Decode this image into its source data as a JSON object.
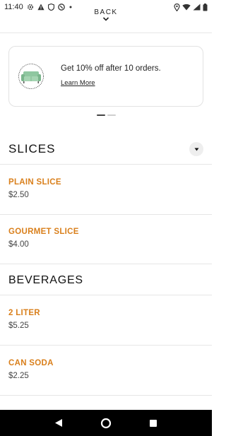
{
  "status_bar": {
    "time": "11:40",
    "left_icons": [
      "gear-icon",
      "alert-icon",
      "shield-icon",
      "vpn-icon",
      "dot-icon"
    ],
    "right_icons": [
      "location-icon",
      "wifi-icon",
      "signal-icon",
      "battery-icon"
    ]
  },
  "header": {
    "back_label": "BACK"
  },
  "promo": {
    "title": "Get 10% off after 10 orders.",
    "link": "Learn More",
    "icon": "sofa-badge-icon",
    "pager_total": 2,
    "pager_active": 0
  },
  "sections": [
    {
      "title": "SLICES",
      "items": [
        {
          "name": "PLAIN SLICE",
          "price": "$2.50"
        },
        {
          "name": "GOURMET SLICE",
          "price": "$4.00"
        }
      ]
    },
    {
      "title": "BEVERAGES",
      "items": [
        {
          "name": "2 LITER",
          "price": "$5.25"
        },
        {
          "name": "CAN SODA",
          "price": "$2.25"
        }
      ]
    }
  ],
  "colors": {
    "item_name": "#d97f1b",
    "nav_bar": "#000000",
    "promo_icon": "#8fc7a0"
  },
  "nav_bar": [
    "back-icon",
    "home-icon",
    "recents-icon"
  ]
}
